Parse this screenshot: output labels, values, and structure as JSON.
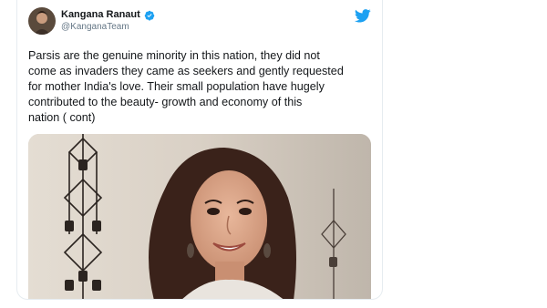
{
  "tweet": {
    "author_name": "Kangana Ranaut",
    "author_handle": "@KanganaTeam",
    "text_lines": [
      "Parsis are the genuine minority in this nation, they did not",
      "come as invaders  they came as seekers and gently requested",
      "for mother India's love. Their small population have hugely",
      "contributed to the beauty- growth and economy of this",
      "nation ( cont)"
    ]
  },
  "icons": {
    "verified": "verified-badge-icon",
    "brand": "twitter-bird-icon"
  },
  "colors": {
    "twitter_blue": "#1da1f2",
    "text": "#14171a",
    "muted": "#657786"
  }
}
